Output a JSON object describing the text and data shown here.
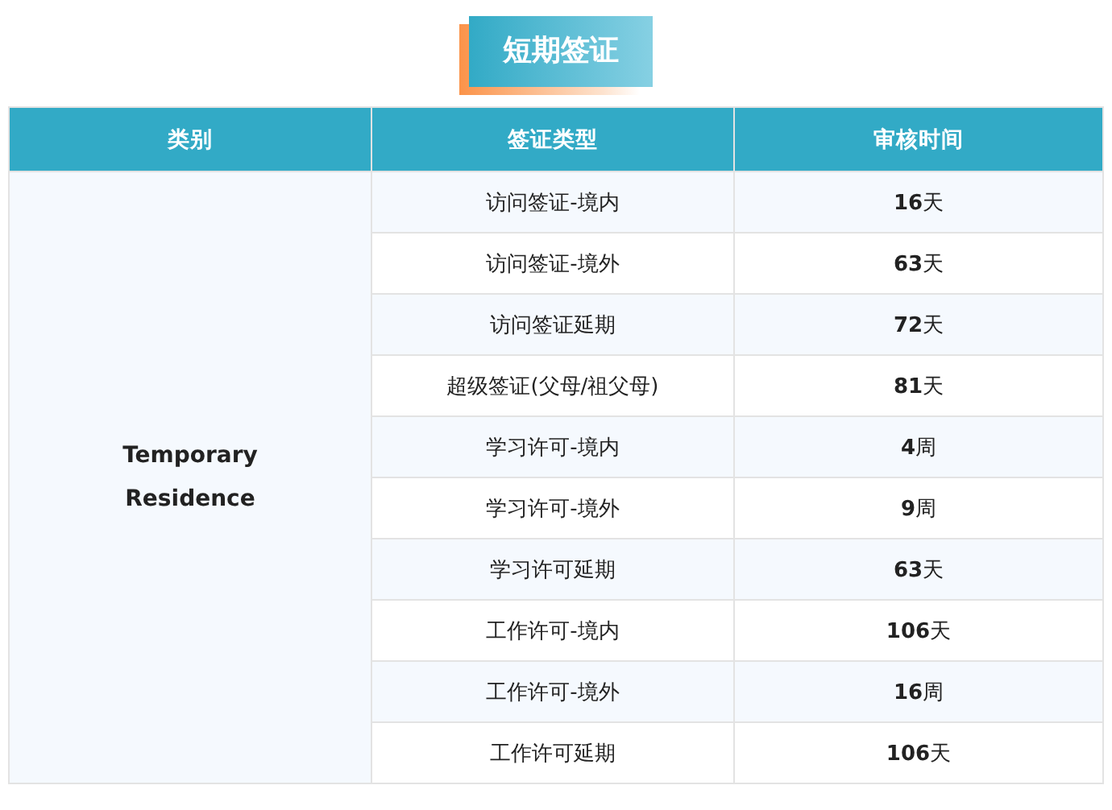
{
  "title": "短期签证",
  "table": {
    "columns": [
      "类别",
      "签证类型",
      "审核时间"
    ],
    "category": "Temporary Residence",
    "rows": [
      {
        "visa_type": "访问签证-境内",
        "time": "**16**天"
      },
      {
        "visa_type": "访问签证-境外",
        "time": "**63**天"
      },
      {
        "visa_type": "访问签证延期",
        "time": "**72**天"
      },
      {
        "visa_type": "超级签证(父母/祖父母)",
        "time": "**81**天"
      },
      {
        "visa_type": "学习许可-境内",
        "time": "**4**周"
      },
      {
        "visa_type": "学习许可-境外",
        "time": "**9**周"
      },
      {
        "visa_type": "学习许可延期",
        "time": "**63**天"
      },
      {
        "visa_type": "工作许可-境内",
        "time": "**106**天"
      },
      {
        "visa_type": "工作许可-境外",
        "time": "**16**周"
      },
      {
        "visa_type": "工作许可延期",
        "time": "**106**天"
      }
    ]
  }
}
